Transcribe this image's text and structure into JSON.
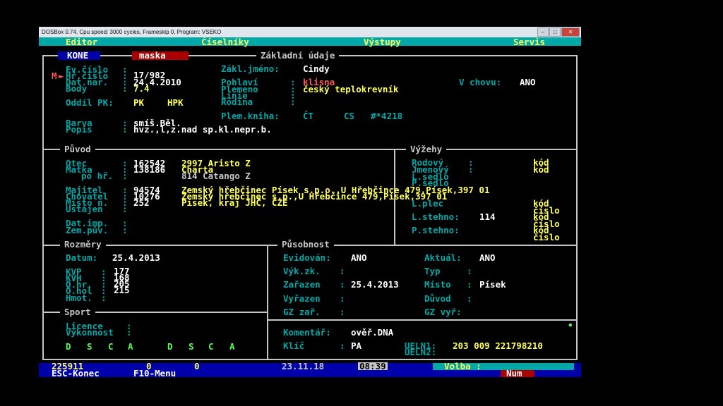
{
  "window": {
    "title": "DOSBox 0.74, Cpu speed:    3000 cycles, Frameskip  0, Program:   VSEKO"
  },
  "menu": {
    "editor": "Editor",
    "ciselniky": "Číselníky",
    "vystupy": "Výstupy",
    "servis": "Servis"
  },
  "tabs": {
    "kone": "KONE",
    "maska": "maska",
    "section": "Základní údaje"
  },
  "marker": "M",
  "basic": {
    "ev_cislo_label": "Ev.číslo",
    "hr_cislo_label": "Hř.číslo",
    "hr_cislo": "17/982",
    "dat_nar_label": "Dat.nar.",
    "dat_nar": "24.4.2010",
    "body_label": "Body",
    "body": "7.4",
    "oddil_label": "Oddíl PK:",
    "oddil_pk": "PK",
    "oddil_hpk": "HPK",
    "zakl_jmeno_label": "Zákl.jméno:",
    "zakl_jmeno": "Cindy",
    "pohlavi_label": "Pohlaví",
    "pohlavi": "klisna",
    "plemeno_label": "Plemeno",
    "plemeno": "český teplokrevník",
    "linie_label": "Linie",
    "rodina_label": "Rodina",
    "v_chovu_label": "V chovu:",
    "v_chovu": "ANO",
    "plem_kniha_label": "Plem.kniha:",
    "plem_kniha_ct": "ČT",
    "plem_kniha_cs": "CS",
    "plem_kniha_num": "#*4218",
    "barva_label": "Barva",
    "barva": "smíš.Běl.",
    "popis_label": "Popis",
    "popis": "hvz.,l,z.nad sp.kl.nepr.b."
  },
  "puvod": {
    "title": "Původ",
    "otec_label": "Otec",
    "otec_id": "162542",
    "otec_name": "2997 Aristo Z",
    "matka_label": "Matka",
    "matka_id": "138186",
    "matka_name": "Charta",
    "po_hr_label": "po hř.",
    "po_hr": "814 Catango Z",
    "majitel_label": "Majitel",
    "majitel_id": "94574",
    "majitel": "Zemský hřebčinec Písek s.p.o.,U Hřebčince 479,Písek,397 01",
    "chovatel_label": "Chovatel",
    "chovatel_id": "10276",
    "chovatel": "Zemský hřebčinec s.p.,U Hřebčince 479,Písek,397 01",
    "misto_label": "Místo n.",
    "misto_id": "252",
    "misto": "Písek, kraj JHČ, ČZE",
    "ustajen_label": "Ustájen",
    "dat_imp_label": "Dat.imp.",
    "zem_puv_label": "Zem.pův."
  },
  "vyzehy": {
    "title": "Výžehy",
    "rodovy_label": "Rodový",
    "jmenovy_label": "Jmenový",
    "l_sedlo_label": "L.sedlo",
    "p_sedlo_label": "P.sedlo",
    "l_plec_label": "L.plec",
    "l_stehno_label": "L.stehno:",
    "l_stehno": "114",
    "p_stehno_label": "P.stehno:",
    "kod": "kód",
    "cislo": "číslo"
  },
  "rozmery": {
    "title": "Rozměry",
    "datum_label": "Datum:",
    "datum": "25.4.2013",
    "kvp_label": "KVP",
    "kvp": "177",
    "kvh_label": "KVH",
    "kvh": "168",
    "o_hr_label": "O.hr.",
    "o_hr": "205",
    "o_hol_label": "O.hol",
    "o_hol": "215",
    "hmot_label": "Hmot."
  },
  "sport": {
    "title": "Sport",
    "licence_label": "Licence",
    "vykonnost_label": "Výkonnost",
    "dsca": [
      "D",
      "S",
      "C",
      "A"
    ]
  },
  "pusobnost": {
    "title": "Působnost",
    "evidovan_label": "Evidován:",
    "evidovan": "ANO",
    "aktual_label": "Aktuál:",
    "aktual": "ANO",
    "vyk_zk_label": "Výk.zk.",
    "typ_label": "Typ",
    "zarazen_label": "Zařazen",
    "zarazen": "25.4.2013",
    "misto_label": "Místo",
    "misto": "Písek",
    "vyrazen_label": "Vyřazen",
    "duvod_label": "Důvod",
    "gz_zar_label": "GZ zař.",
    "gz_vyr_label": "GZ vyř:",
    "komentar_label": "Komentář:",
    "komentar": "ověř.DNA",
    "klic_label": "Klíč",
    "klic": "PA",
    "ueln1_label": "UELN1:",
    "ueln1": "203 009 221798210",
    "ueln2_label": "UELN2:"
  },
  "status": {
    "id": "225911",
    "n1": "0",
    "n2": "0",
    "date": "23.11.18",
    "time": "08:39",
    "volba": "Volba :",
    "esc": "ESC-Konec",
    "f10": "F10-Menu",
    "num": "Num"
  }
}
